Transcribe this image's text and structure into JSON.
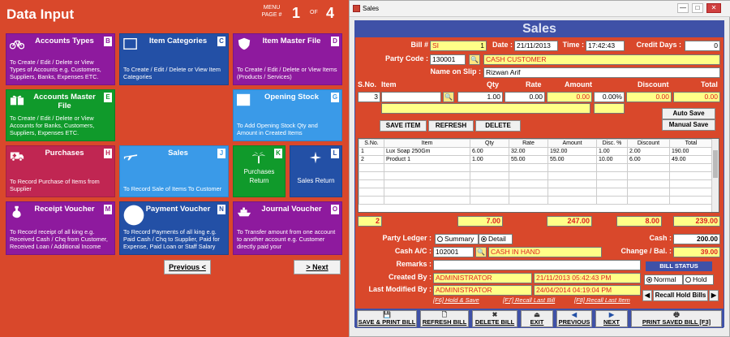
{
  "left": {
    "title": "Data Input",
    "menu_label": "MENU",
    "page_label": "PAGE #",
    "current_page": "1",
    "of_label": "OF",
    "total_pages": "4"
  },
  "tiles": {
    "accounts_types": {
      "title": "Accounts Types",
      "letter": "B",
      "desc": "To Create / Edit / Delete or View Types of Accounts e.g. Customers, Suppliers, Banks, Expenses ETC."
    },
    "item_categories": {
      "title": "Item Categories",
      "letter": "C",
      "desc": "To Create / Edit / Delete or View Item Categories"
    },
    "item_master": {
      "title": "Item Master File",
      "letter": "D",
      "desc": "To Create / Edit / Delete or View Items (Products / Services)"
    },
    "accounts_master": {
      "title": "Accounts Master File",
      "letter": "E",
      "desc": "To Create / Edit / Delete or View Accounts for Banks, Customers, Suppliers, Expenses ETC."
    },
    "opening_stock": {
      "title": "Opening Stock",
      "letter": "G",
      "desc": "To Add Opening Stock Qty and Amount in Created Items"
    },
    "purchases": {
      "title": "Purchases",
      "letter": "H",
      "desc": "To Record Purchase of Items from Supplier"
    },
    "sales": {
      "title": "Sales",
      "letter": "J",
      "desc": "To Record Sale of Items To Customer"
    },
    "purchases_return": {
      "title": "Purchases Return",
      "letter": "K"
    },
    "sales_return": {
      "title": "Sales Return",
      "letter": "L"
    },
    "receipt_voucher": {
      "title": "Receipt Voucher",
      "letter": "M",
      "desc": "To Record receipt of all king e.g. Received Cash / Chq from Customer, Received Loan / Additional Income"
    },
    "payment_voucher": {
      "title": "Payment Voucher",
      "letter": "N",
      "desc": "To Record Payments of all king e.g. Paid Cash / Chq to Supplier, Paid for Expense, Paid Loan or Staff Salary"
    },
    "journal_voucher": {
      "title": "Journal Voucher",
      "letter": "O",
      "desc": "To Transfer amount from one account to another account e.g. Customer directly paid your"
    }
  },
  "nav": {
    "previous": "Previous <",
    "next": "> Next"
  },
  "window": {
    "title": "Sales",
    "min": "—",
    "max": "□",
    "close": "✕"
  },
  "sales": {
    "header": "Sales",
    "bill_label": "Bill #",
    "bill_prefix": "SI",
    "bill_no": "1",
    "date_label": "Date :",
    "date": "21/11/2013",
    "time_label": "Time :",
    "time": "17:42:43",
    "credit_label": "Credit Days :",
    "credit_days": "0",
    "party_label": "Party Code :",
    "party_code": "130001",
    "party_name": "CASH CUSTOMER",
    "slip_label": "Name on Slip :",
    "slip_name": "Rizwan Arif",
    "entry_headers": {
      "sno": "S.No.",
      "item": "Item",
      "qty": "Qty",
      "rate": "Rate",
      "amount": "Amount",
      "discount": "Discount",
      "total": "Total"
    },
    "entry_row": {
      "sno": "3",
      "qty": "1.00",
      "rate": "0.00",
      "amount": "0.00",
      "disc_pct": "0.00%",
      "discount": "0.00",
      "total": "0.00"
    },
    "auto_save": "Auto Save",
    "manual_save": "Manual Save",
    "save_item": "SAVE ITEM",
    "refresh": "REFRESH",
    "delete": "DELETE",
    "grid_headers": [
      "S.No.",
      "Item",
      "Qty",
      "Rate",
      "Amount",
      "Disc. %",
      "Discount",
      "Total"
    ],
    "grid_rows": [
      [
        "1",
        "Lux Soap 250Gm",
        "6.00",
        "32.00",
        "192.00",
        "1.00",
        "2.00",
        "190.00"
      ],
      [
        "2",
        "Product 1",
        "1.00",
        "55.00",
        "55.00",
        "10.00",
        "6.00",
        "49.00"
      ]
    ],
    "totals": {
      "count": "2",
      "qty": "7.00",
      "amount": "247.00",
      "discount": "8.00",
      "total": "239.00"
    },
    "ledger_label": "Party Ledger :",
    "summary": "Summary",
    "detail": "Detail",
    "cash_ac_label": "Cash A/C :",
    "cash_ac_code": "102001",
    "cash_ac_name": "CASH IN HAND",
    "cash_label": "Cash :",
    "cash": "200.00",
    "change_label": "Change / Bal. :",
    "change": "39.00",
    "remarks_label": "Remarks :",
    "created_label": "Created By :",
    "created_by": "ADMINISTRATOR",
    "created_at": "21/11/2013 05:42:43 PM",
    "modified_label": "Last Modified By :",
    "modified_by": "ADMINISTRATOR",
    "modified_at": "24/04/2014 04:19:04 PM",
    "bill_status": "BILL STATUS",
    "normal": "Normal",
    "hold": "Hold",
    "recall_hold": "Recall Hold Bills",
    "hint_f6": "[F6] Hold & Save",
    "hint_f7": "[F7] Recall Last Bill",
    "hint_f8": "[F8] Recall Last Item",
    "buttons": {
      "save_print": "SAVE & PRINT BILL",
      "refresh_bill": "REFRESH BILL",
      "delete_bill": "DELETE BILL",
      "exit": "EXIT",
      "previous": "PREVIOUS",
      "next": "NEXT",
      "print_saved": "PRINT SAVED BILL [F3]"
    }
  },
  "colors": {
    "orange": "#d9482b",
    "blue": "#3f51a7",
    "purple": "#8e1a9e",
    "green": "#109a2b",
    "navy": "#2350a6",
    "sky": "#3a9ae8",
    "crimson": "#c02652",
    "yellow": "#ffff88"
  }
}
